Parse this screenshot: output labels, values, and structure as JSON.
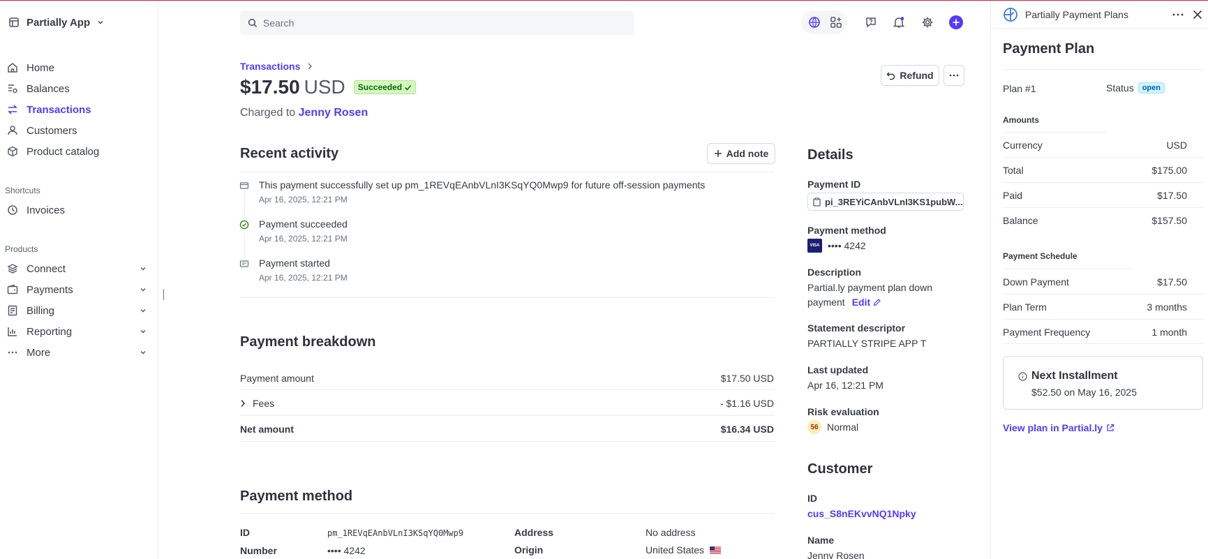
{
  "sidebar": {
    "account_name": "Partially App",
    "nav": [
      {
        "label": "Home",
        "icon": "home-icon"
      },
      {
        "label": "Balances",
        "icon": "balances-icon"
      },
      {
        "label": "Transactions",
        "icon": "transactions-icon",
        "active": true
      },
      {
        "label": "Customers",
        "icon": "customers-icon"
      },
      {
        "label": "Product catalog",
        "icon": "product-catalog-icon"
      }
    ],
    "shortcuts_label": "Shortcuts",
    "shortcuts": [
      {
        "label": "Invoices",
        "icon": "invoices-icon"
      }
    ],
    "products_label": "Products",
    "products": [
      {
        "label": "Connect",
        "icon": "connect-icon"
      },
      {
        "label": "Payments",
        "icon": "payments-icon"
      },
      {
        "label": "Billing",
        "icon": "billing-icon"
      },
      {
        "label": "Reporting",
        "icon": "reporting-icon"
      },
      {
        "label": "More",
        "icon": "more-icon"
      }
    ]
  },
  "topbar": {
    "search_placeholder": "Search"
  },
  "transaction": {
    "breadcrumb": "Transactions",
    "amount": "$17.50",
    "currency": "USD",
    "status": "Succeeded",
    "charged_prefix": "Charged to",
    "customer_name": "Jenny Rosen",
    "refund_label": "Refund"
  },
  "activity": {
    "title": "Recent activity",
    "add_note_label": "Add note",
    "items": [
      {
        "title": "This payment successfully set up pm_1REVqEAnbVLnI3KSqYQ0Mwp9 for future off-session payments",
        "time": "Apr 16, 2025, 12:21 PM"
      },
      {
        "title": "Payment succeeded",
        "time": "Apr 16, 2025, 12:21 PM"
      },
      {
        "title": "Payment started",
        "time": "Apr 16, 2025, 12:21 PM"
      }
    ]
  },
  "breakdown": {
    "title": "Payment breakdown",
    "rows": [
      {
        "label": "Payment amount",
        "value": "$17.50 USD"
      },
      {
        "label": "Fees",
        "value": "- $1.16 USD"
      },
      {
        "label": "Net amount",
        "value": "$16.34 USD"
      }
    ]
  },
  "payment_method": {
    "title": "Payment method",
    "id_label": "ID",
    "id_value": "pm_1REVqEAnbVLnI3KSqYQ0Mwp9",
    "number_label": "Number",
    "number_value": "•••• 4242",
    "address_label": "Address",
    "address_value": "No address",
    "origin_label": "Origin",
    "origin_value": "United States"
  },
  "details": {
    "title": "Details",
    "payment_id_label": "Payment ID",
    "payment_id_value": "pi_3REYiCAnbVLnI3KS1pubW...",
    "payment_method_label": "Payment method",
    "card_brand": "VISA",
    "card_last4": "•••• 4242",
    "description_label": "Description",
    "description_line1": "Partial.ly payment plan down",
    "description_line2": "payment",
    "edit_label": "Edit",
    "statement_label": "Statement descriptor",
    "statement_value": "PARTIALLY STRIPE APP T",
    "last_updated_label": "Last updated",
    "last_updated_value": "Apr 16, 12:21 PM",
    "risk_label": "Risk evaluation",
    "risk_score": "56",
    "risk_value": "Normal"
  },
  "customer": {
    "title": "Customer",
    "id_label": "ID",
    "id_value": "cus_S8nEKvvNQ1Npky",
    "name_label": "Name",
    "name_value": "Jenny Rosen"
  },
  "panel": {
    "app_name": "Partially Payment Plans",
    "title": "Payment Plan",
    "plan_label": "Plan #1",
    "status_label": "Status",
    "status_value": "open",
    "amounts_label": "Amounts",
    "amounts": [
      {
        "label": "Currency",
        "value": "USD"
      },
      {
        "label": "Total",
        "value": "$175.00"
      },
      {
        "label": "Paid",
        "value": "$17.50"
      },
      {
        "label": "Balance",
        "value": "$157.50"
      }
    ],
    "schedule_label": "Payment Schedule",
    "schedule": [
      {
        "label": "Down Payment",
        "value": "$17.50"
      },
      {
        "label": "Plan Term",
        "value": "3 months"
      },
      {
        "label": "Payment Frequency",
        "value": "1 month"
      }
    ],
    "next_title": "Next Installment",
    "next_value": "$52.50 on May 16, 2025",
    "view_link": "View plan in Partial.ly"
  },
  "colors": {
    "accent": "#533afd",
    "success_bg": "#d7f7c2",
    "top_border": "#df1b41"
  }
}
